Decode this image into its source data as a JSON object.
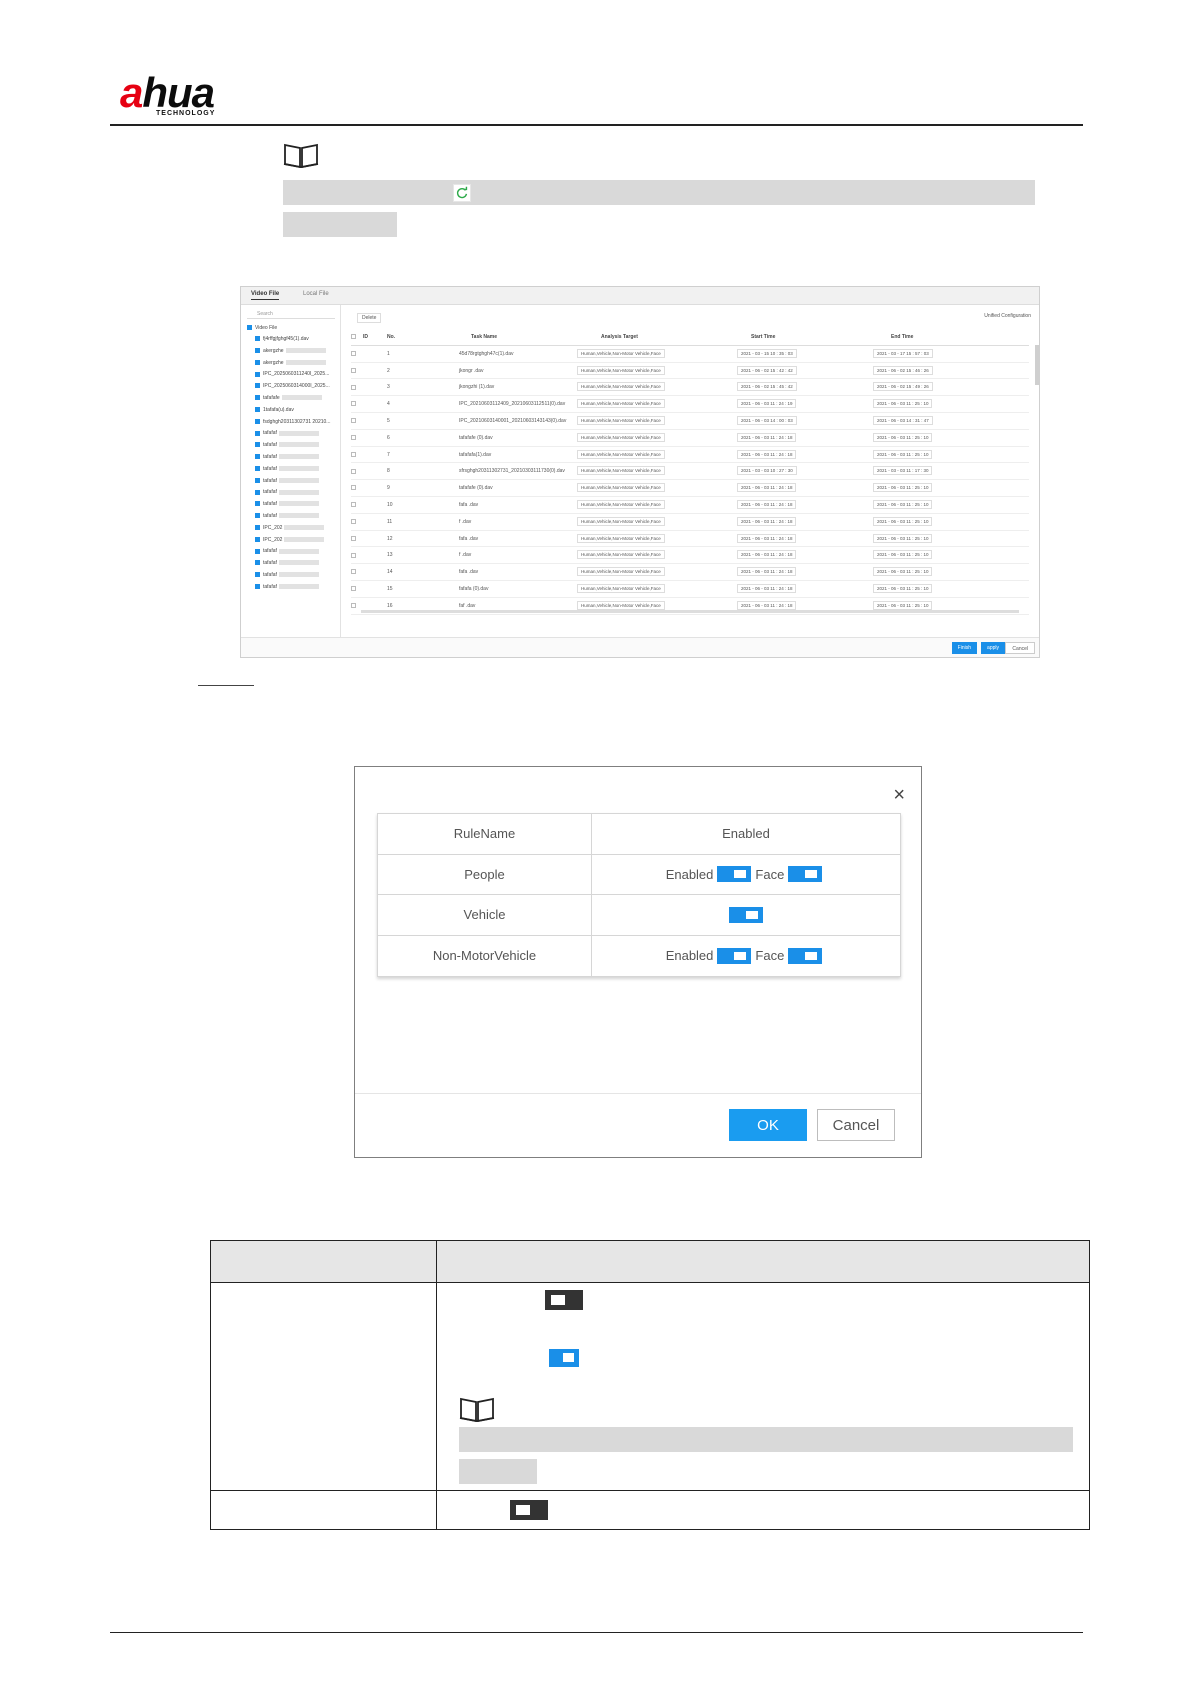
{
  "header": {
    "logo_text_a": "a",
    "logo_text_rest": "hua",
    "logo_sub": "TECHNOLOGY"
  },
  "screenshot": {
    "tabs": [
      "Video File",
      "Local File"
    ],
    "search_placeholder": "Search",
    "tree_root": "Video File",
    "tree_items": [
      "fj4rffgjfghgf45(1).dav",
      "akergzhe",
      "akergzhe",
      "IPC_2025060311240I_2025...",
      "IPC_2025060314000I_2025...",
      "tafafafe",
      "1tafafa(u).dav",
      "fsdghgh20311302731 20210...",
      "tafafaf",
      "tafafaf",
      "tafafaf",
      "tafafaf",
      "tafafaf",
      "tafafaf",
      "tafafaf",
      "tafafaf",
      "IPC_202",
      "IPC_202",
      "tafafaf",
      "tafafaf",
      "tafafaf",
      "tafafaf"
    ],
    "toolbar_delete": "Delete",
    "toolbar_config": "Unified Configuration",
    "columns": [
      "ID",
      "No.",
      "Task Name",
      "Analysis Target",
      "Start Time",
      "End Time"
    ],
    "rows": [
      {
        "no": "1",
        "name": "45d78rgtghgh47c(1).dav",
        "target": "Human,Vehicle,Non-Motor Vehicle,Face",
        "start": "2021 - 03 - 15  10 : 35 : 03",
        "end": "2021 - 03 - 17  15 : 57 : 03"
      },
      {
        "no": "2",
        "name": "jkongr .dav",
        "target": "Human,Vehicle,Non-Motor Vehicle,Face",
        "start": "2021 - 06 - 02  15 : 42 : 42",
        "end": "2021 - 06 - 02  15 : 46 : 26"
      },
      {
        "no": "3",
        "name": "jkongzhi (1).dav",
        "target": "Human,Vehicle,Non-Motor Vehicle,Face",
        "start": "2021 - 06 - 02  15 : 45 : 42",
        "end": "2021 - 06 - 02  15 : 49 : 26"
      },
      {
        "no": "4",
        "name": "IPC_20210603112409_20210603112511(0).dav",
        "target": "Human,Vehicle,Non-Motor Vehicle,Face",
        "start": "2021 - 06 - 03  11 : 24 : 19",
        "end": "2021 - 06 - 03  11 : 25 : 10"
      },
      {
        "no": "5",
        "name": "IPC_20210603140001_20210603143143(0).dav",
        "target": "Human,Vehicle,Non-Motor Vehicle,Face",
        "start": "2021 - 06 - 03  14 : 00 : 03",
        "end": "2021 - 06 - 03  14 : 31 : 47"
      },
      {
        "no": "6",
        "name": "tafafafe (0).dav",
        "target": "Human,Vehicle,Non-Motor Vehicle,Face",
        "start": "2021 - 06 - 03  11 : 24 : 18",
        "end": "2021 - 06 - 03  11 : 25 : 10"
      },
      {
        "no": "7",
        "name": "tafafafa(1).dav",
        "target": "Human,Vehicle,Non-Motor Vehicle,Face",
        "start": "2021 - 06 - 03  11 : 24 : 18",
        "end": "2021 - 06 - 03  11 : 25 : 10"
      },
      {
        "no": "8",
        "name": "sfrsghgh20311302731_20210303111730(0).dav",
        "target": "Human,Vehicle,Non-Motor Vehicle,Face",
        "start": "2021 - 03 - 03  10 : 27 : 30",
        "end": "2021 - 03 - 03  11 : 17 : 30"
      },
      {
        "no": "9",
        "name": "tafafafe (0).dav",
        "target": "Human,Vehicle,Non-Motor Vehicle,Face",
        "start": "2021 - 06 - 03  11 : 24 : 18",
        "end": "2021 - 06 - 03  11 : 25 : 10"
      },
      {
        "no": "10",
        "name": "fafa .dav",
        "target": "Human,Vehicle,Non-Motor Vehicle,Face",
        "start": "2021 - 06 - 03  11 : 24 : 18",
        "end": "2021 - 06 - 03  11 : 25 : 10"
      },
      {
        "no": "11",
        "name": "f .dav",
        "target": "Human,Vehicle,Non-Motor Vehicle,Face",
        "start": "2021 - 06 - 03  11 : 24 : 18",
        "end": "2021 - 06 - 03  11 : 25 : 10"
      },
      {
        "no": "12",
        "name": "fafa .dav",
        "target": "Human,Vehicle,Non-Motor Vehicle,Face",
        "start": "2021 - 06 - 03  11 : 24 : 18",
        "end": "2021 - 06 - 03  11 : 25 : 10"
      },
      {
        "no": "13",
        "name": "f .dav",
        "target": "Human,Vehicle,Non-Motor Vehicle,Face",
        "start": "2021 - 06 - 03  11 : 24 : 18",
        "end": "2021 - 06 - 03  11 : 25 : 10"
      },
      {
        "no": "14",
        "name": "fafa .dav",
        "target": "Human,Vehicle,Non-Motor Vehicle,Face",
        "start": "2021 - 06 - 03  11 : 24 : 18",
        "end": "2021 - 06 - 03  11 : 25 : 10"
      },
      {
        "no": "15",
        "name": "fafafa (0).dav",
        "target": "Human,Vehicle,Non-Motor Vehicle,Face",
        "start": "2021 - 06 - 03  11 : 24 : 18",
        "end": "2021 - 06 - 03  11 : 25 : 10"
      },
      {
        "no": "16",
        "name": "faf .dav",
        "target": "Human,Vehicle,Non-Motor Vehicle,Face",
        "start": "2021 - 06 - 03  11 : 24 : 18",
        "end": "2021 - 06 - 03  11 : 25 : 10"
      }
    ],
    "footer_finish": "Finish",
    "footer_apply": "apply",
    "footer_cancel": "Cancel"
  },
  "dialog": {
    "close_glyph": "×",
    "header_rule": "RuleName",
    "header_enabled": "Enabled",
    "rules": [
      {
        "name": "People",
        "enabled_label": "Enabled",
        "face_label": "Face",
        "enabled_on": true,
        "face_on": true,
        "single": false
      },
      {
        "name": "Vehicle",
        "enabled_label": "",
        "face_label": "",
        "enabled_on": true,
        "single": true
      },
      {
        "name": "Non-MotorVehicle",
        "enabled_label": "Enabled",
        "face_label": "Face",
        "enabled_on": true,
        "face_on": true,
        "single": false
      }
    ],
    "ok_label": "OK",
    "cancel_label": "Cancel"
  },
  "colors": {
    "accent": "#1a8fe8",
    "brand_red": "#e60012",
    "switch_off": "#333333",
    "redaction": "#d9d9d9"
  },
  "icons": [
    "note-book-icon",
    "refresh-icon",
    "close-icon",
    "toggle-on-icon",
    "toggle-off-icon"
  ]
}
